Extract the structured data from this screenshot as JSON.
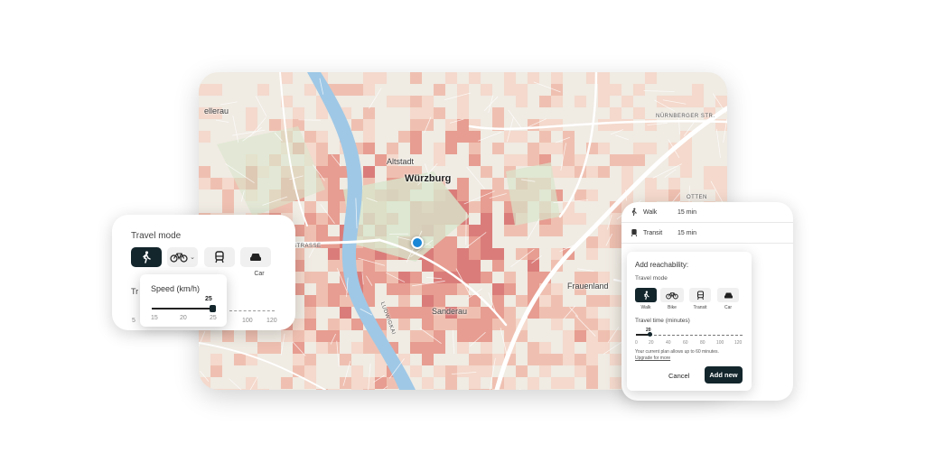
{
  "colors": {
    "primary_dark": "#13262c",
    "heat_low": "#f5d6c8",
    "heat_mid": "#e58f82",
    "heat_high": "#c44d52",
    "river": "#9fc8e6",
    "park": "#d8e6cc",
    "pin": "#1a86d6"
  },
  "map": {
    "labels": {
      "place_tl": "ellerau",
      "altstadt": "Altstadt",
      "wurzburg": "Würzburg",
      "strasse": "STRASSE",
      "sanderau": "Sanderau",
      "frauenland": "Frauenland",
      "nurnberger": "NÜRNBERGER STR.",
      "ottendorf": "OTTEN",
      "ludwigkai": "LUDWIGKAI"
    }
  },
  "travel_mode_card": {
    "title": "Travel mode",
    "modes": [
      {
        "icon": "walk-icon",
        "label": "Walk",
        "active": true
      },
      {
        "icon": "bike-icon",
        "label": "Bike",
        "active": false
      },
      {
        "icon": "transit-icon",
        "label": "Transit",
        "active": false
      },
      {
        "icon": "car-icon",
        "label": "Car",
        "active": false
      }
    ],
    "travel_label_partial": "Tr",
    "ticks_visible": [
      "5",
      "100",
      "120"
    ],
    "speed_popup": {
      "title": "Speed (km/h)",
      "value": "25",
      "ticks": [
        "15",
        "20",
        "25"
      ]
    }
  },
  "reachability_card": {
    "list": [
      {
        "icon": "walk-icon",
        "mode": "Walk",
        "time": "15 min"
      },
      {
        "icon": "transit-icon",
        "mode": "Transit",
        "time": "15 min"
      }
    ],
    "panel": {
      "title": "Add reachability:",
      "travel_mode_label": "Travel mode",
      "modes": [
        {
          "icon": "walk-icon",
          "label": "Walk",
          "active": true
        },
        {
          "icon": "bike-icon",
          "label": "Bike",
          "active": false
        },
        {
          "icon": "transit-icon",
          "label": "Transit",
          "active": false
        },
        {
          "icon": "car-icon",
          "label": "Car",
          "active": false
        }
      ],
      "travel_time_label": "Travel time (minutes)",
      "travel_time_value": "20",
      "ticks": [
        "0",
        "20",
        "40",
        "60",
        "80",
        "100",
        "120"
      ],
      "note": "Your current plan allows up to 60 minutes.",
      "upgrade_link": "Upgrade for more",
      "cancel": "Cancel",
      "add_new": "Add new"
    }
  }
}
